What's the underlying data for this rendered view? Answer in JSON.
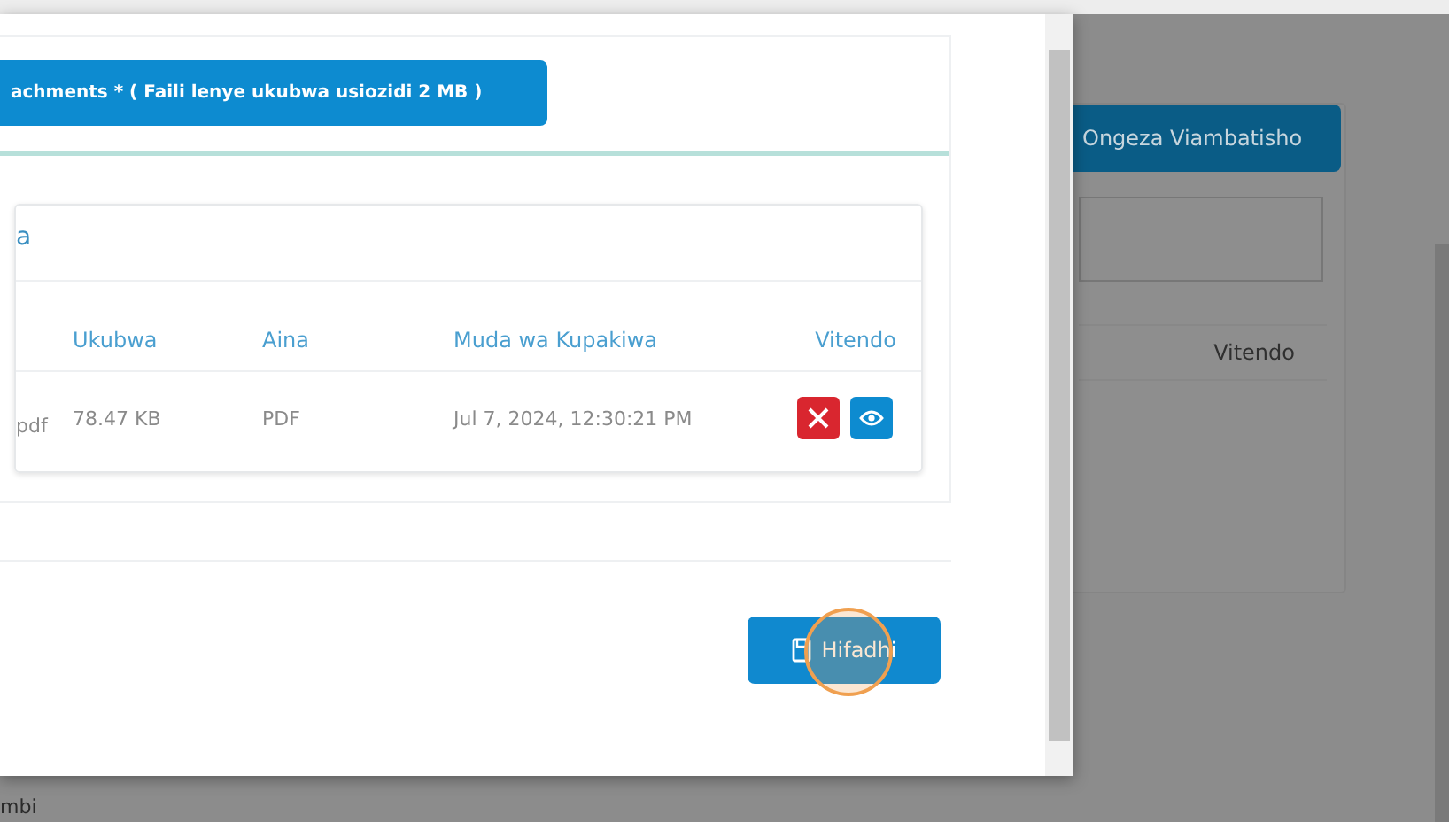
{
  "background_page": {
    "add_button": "Ongeza Viambatisho",
    "table_header": "Vitendo",
    "footer_text": "mbi"
  },
  "modal": {
    "upload_button": "achments * ( Faili lenye ukubwa usiozidi 2 MB )",
    "card_title": "a",
    "table": {
      "columns": [
        "Ukubwa",
        "Aina",
        "Muda wa Kupakiwa",
        "Vitendo"
      ],
      "rows": [
        {
          "name": "pdf",
          "size": "78.47 KB",
          "type": "PDF",
          "uploaded": "Jul 7, 2024, 12:30:21 PM"
        }
      ]
    },
    "save_button": "Hifadhi",
    "click_indicator": true
  }
}
